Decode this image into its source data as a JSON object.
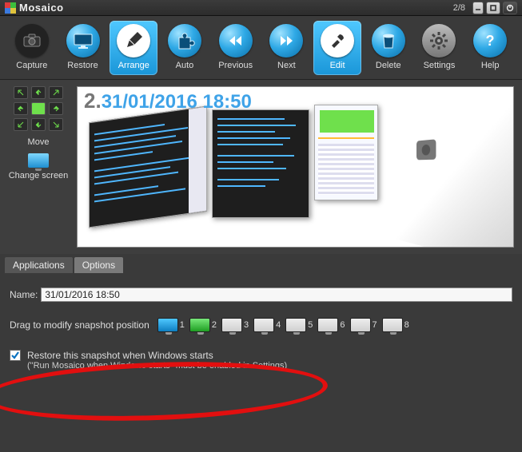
{
  "titlebar": {
    "app_name": "Mosaico",
    "workspace_indicator": "2/8"
  },
  "toolbar": {
    "items": [
      {
        "label": "Capture"
      },
      {
        "label": "Restore"
      },
      {
        "label": "Arrange"
      },
      {
        "label": "Auto"
      },
      {
        "label": "Previous"
      },
      {
        "label": "Next"
      },
      {
        "label": "Edit"
      },
      {
        "label": "Delete"
      },
      {
        "label": "Settings"
      },
      {
        "label": "Help"
      }
    ]
  },
  "side": {
    "move_label": "Move",
    "change_screen_label": "Change screen"
  },
  "stage": {
    "snapshot_index": "2.",
    "snapshot_title": "31/01/2016 18:50"
  },
  "tabs": {
    "applications": "Applications",
    "options": "Options"
  },
  "options": {
    "name_label": "Name:",
    "name_value": "31/01/2016 18:50",
    "drag_label": "Drag to modify snapshot position",
    "positions": [
      "1",
      "2",
      "3",
      "4",
      "5",
      "6",
      "7",
      "8"
    ],
    "restore_label": "Restore this snapshot when Windows starts",
    "restore_hint": "(\"Run Mosaico when Windows starts\" must be enabled in Settings)"
  }
}
